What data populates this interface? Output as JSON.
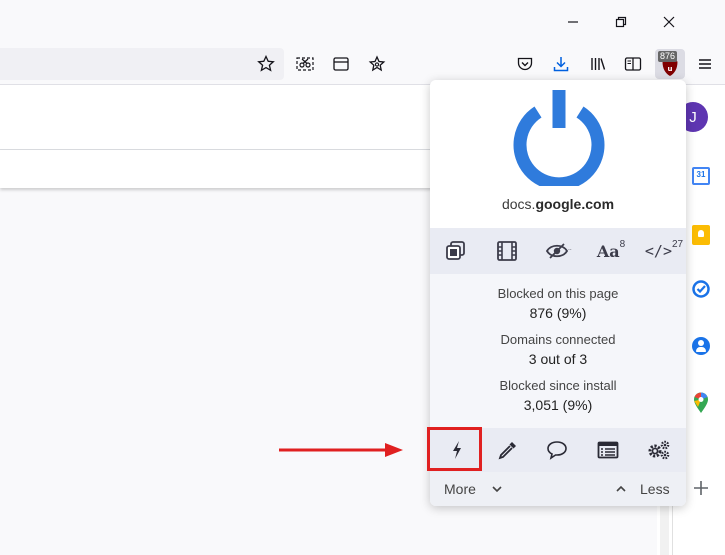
{
  "popup": {
    "hostname_prefix": "docs.",
    "hostname_domain": "google.com",
    "tools": [
      {
        "icon": "element-zapper-list-icon",
        "badge": ""
      },
      {
        "icon": "film-media-icon",
        "badge": ""
      },
      {
        "icon": "eye-cosmetic-icon",
        "badge": "..."
      },
      {
        "icon": "font-icon",
        "label": "Aa",
        "badge": "8"
      },
      {
        "icon": "code-script-icon",
        "label": "</>",
        "badge": "27"
      }
    ],
    "stats": {
      "blocked_page_label": "Blocked on this page",
      "blocked_page_value": "876 (9%)",
      "domains_label": "Domains connected",
      "domains_value": "3 out of 3",
      "blocked_install_label": "Blocked since install",
      "blocked_install_value": "3,051 (9%)"
    },
    "footer": {
      "more_label": "More",
      "less_label": "Less"
    }
  },
  "toolbar": {
    "ublock_badge": "876"
  },
  "sidepanel": {
    "avatar_letter": "J",
    "calendar_day": "31"
  },
  "colors": {
    "power_blue": "#2f7bdc",
    "highlight_red": "#e02020",
    "ublock_red": "#800000"
  }
}
